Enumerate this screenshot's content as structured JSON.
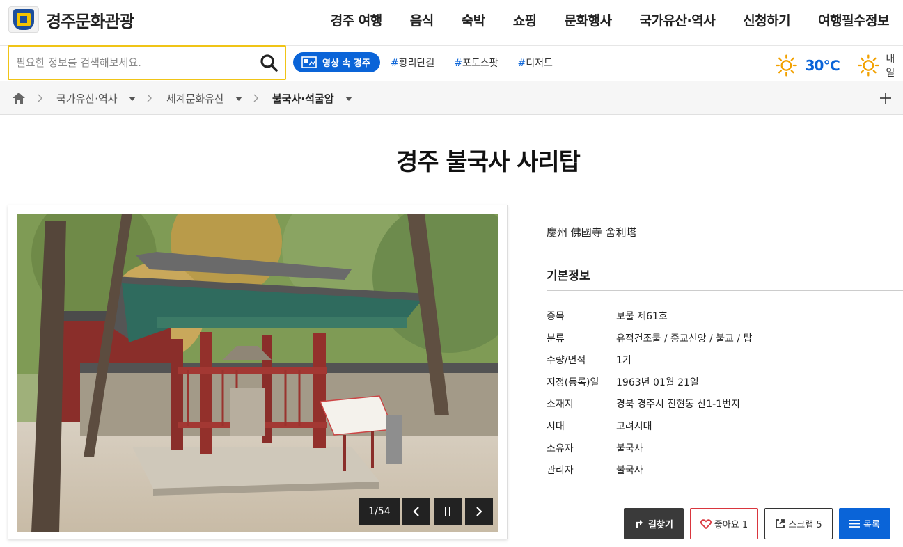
{
  "header": {
    "logo_text": "경주문화관광",
    "nav": [
      "경주 여행",
      "음식",
      "숙박",
      "쇼핑",
      "문화행사",
      "국가유산·역사",
      "신청하기",
      "여행필수정보"
    ]
  },
  "search": {
    "placeholder": "필요한 정보를 검색해보세요.",
    "video_label": "영상 속 경주",
    "tags": [
      "황리단길",
      "포토스팟",
      "디저트"
    ]
  },
  "weather": {
    "today_temp": "30℃",
    "tomorrow_label": "내일"
  },
  "breadcrumb": [
    "국가유산·역사",
    "세계문화유산",
    "불국사·석굴암"
  ],
  "page": {
    "title": "경주 불국사 사리탑"
  },
  "gallery": {
    "counter": "1/54"
  },
  "info": {
    "hanja": "慶州 佛國寺 舍利塔",
    "section_title": "기본정보",
    "rows": [
      {
        "k": "종목",
        "v": "보물 제61호"
      },
      {
        "k": "분류",
        "v": "유적건조물 / 종교신앙 / 불교 / 탑"
      },
      {
        "k": "수량/면적",
        "v": "1기"
      },
      {
        "k": "지정(등록)일",
        "v": "1963년 01월 21일"
      },
      {
        "k": "소재지",
        "v": "경북 경주시 진현동 산1-1번지"
      },
      {
        "k": "시대",
        "v": "고려시대"
      },
      {
        "k": "소유자",
        "v": "불국사"
      },
      {
        "k": "관리자",
        "v": "불국사"
      }
    ]
  },
  "actions": {
    "directions": "길찾기",
    "like": "좋아요 1",
    "scrap": "스크랩 5",
    "list": "목록"
  },
  "colors": {
    "accent": "#0a64d8",
    "search_border": "#f0c417",
    "dark_button": "#3a3a3a",
    "like_red": "#d9363e"
  }
}
